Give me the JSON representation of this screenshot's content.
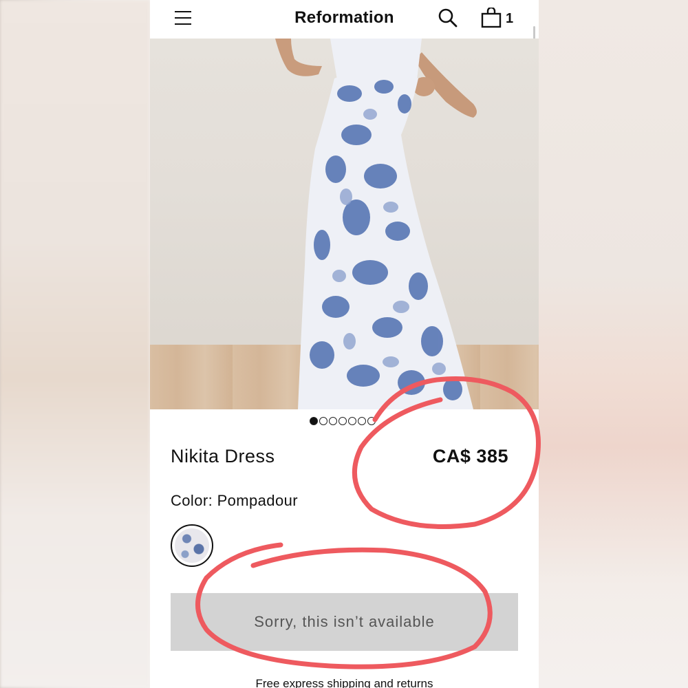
{
  "header": {
    "brand": "Reformation",
    "icons": {
      "menu": "hamburger-menu-icon",
      "search": "search-icon",
      "bag": "shopping-bag-icon"
    },
    "bag_count": "1"
  },
  "gallery": {
    "image_count": 7,
    "active_index": 0,
    "dress_colors": {
      "print_blue": "#4f6fb0",
      "print_base": "#eef0f6"
    }
  },
  "product": {
    "name": "Nikita Dress",
    "price": "CA$ 385",
    "color_label": "Color: Pompadour"
  },
  "cta": {
    "label": "Sorry, this isn’t available"
  },
  "footer": {
    "shipping": "Free express shipping and returns"
  },
  "colors": {
    "accent_annotation": "#ee5a5f",
    "button_bg": "#d3d3d3",
    "text": "#111111"
  }
}
